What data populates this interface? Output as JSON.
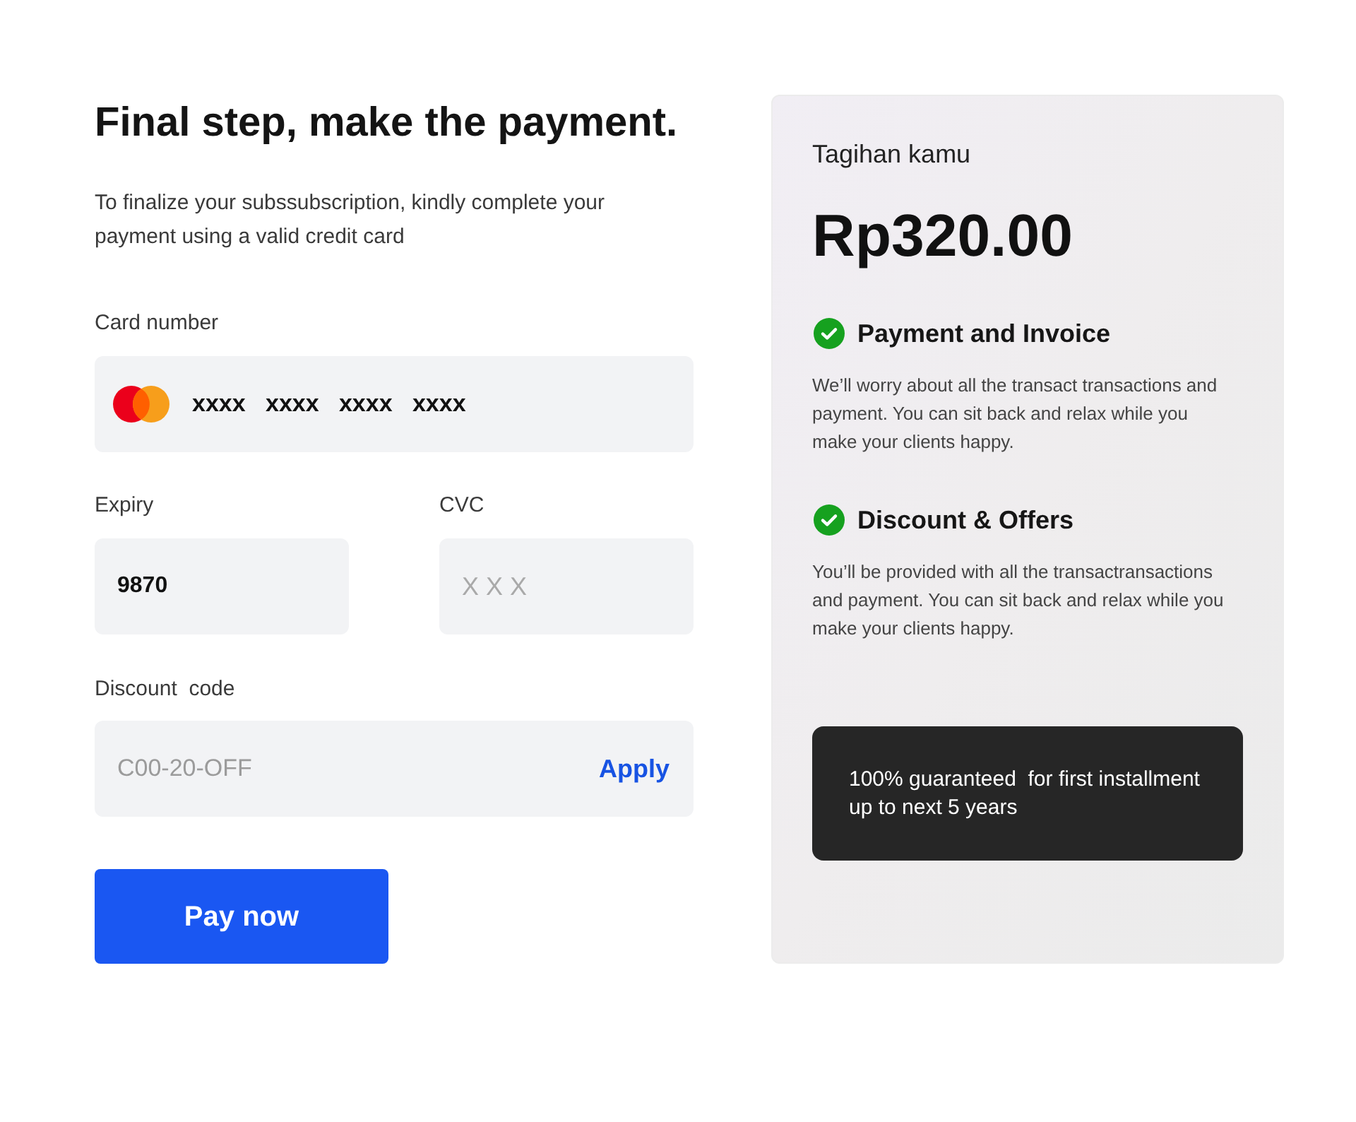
{
  "heading": "Final step, make the payment.",
  "intro": "To finalize your subssubscription, kindly complete your payment using a valid credit card",
  "card_number": {
    "label": "Card number",
    "value": "xxxx   xxxx   xxxx   xxxx"
  },
  "expiry": {
    "label": "Expiry",
    "value": "9870"
  },
  "cvc": {
    "label": "CVC",
    "placeholder": "X X X"
  },
  "discount": {
    "label": "Discount  code",
    "placeholder": "C00-20-OFF",
    "button": "Apply"
  },
  "pay_button": "Pay now",
  "summary": {
    "title": "Tagihan kamu",
    "amount": "Rp320.00",
    "features": [
      {
        "title": "Payment and Invoice",
        "description": "We’ll worry about all the transact transactions and payment. You can sit back and relax while you make your clients happy."
      },
      {
        "title": "Discount & Offers",
        "description": "You’ll be provided with all the transactransactions and payment. You can sit back and relax while you make your clients happy."
      }
    ],
    "guarantee": "100% guaranteed  for first installment up to next 5 years"
  }
}
